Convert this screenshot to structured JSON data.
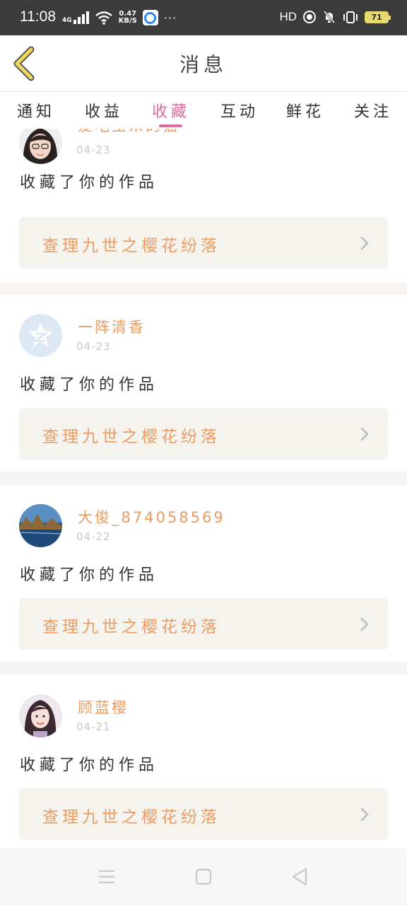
{
  "status_bar": {
    "time": "11:08",
    "network_type": "4G",
    "speed_value": "0.47",
    "speed_unit": "KB/S",
    "more": "···",
    "hd": "HD",
    "battery": "71"
  },
  "header": {
    "title": "消息"
  },
  "tabs": [
    {
      "label": "通知",
      "active": false
    },
    {
      "label": "收益",
      "active": false
    },
    {
      "label": "收藏",
      "active": true
    },
    {
      "label": "互动",
      "active": false
    },
    {
      "label": "鲜花",
      "active": false
    },
    {
      "label": "关注",
      "active": false
    }
  ],
  "colors": {
    "accent_pink": "#e06aa0",
    "username_orange": "#ec9b62"
  },
  "messages": [
    {
      "username": "爱吃玉米的猫",
      "date": "04-23",
      "action": "收藏了你的作品",
      "work_title": "查理九世之樱花纷落",
      "avatar": "girl-glasses-avatar"
    },
    {
      "username": "一阵清香",
      "date": "04-23",
      "action": "收藏了你的作品",
      "work_title": "查理九世之樱花纷落",
      "avatar": "default-star-avatar"
    },
    {
      "username": "大俊_874058569",
      "date": "04-22",
      "action": "收藏了你的作品",
      "work_title": "查理九世之樱花纷落",
      "avatar": "landscape-avatar"
    },
    {
      "username": "顾蓝樱",
      "date": "04-21",
      "action": "收藏了你的作品",
      "work_title": "查理九世之樱花纷落",
      "avatar": "girl-photo-avatar"
    }
  ]
}
